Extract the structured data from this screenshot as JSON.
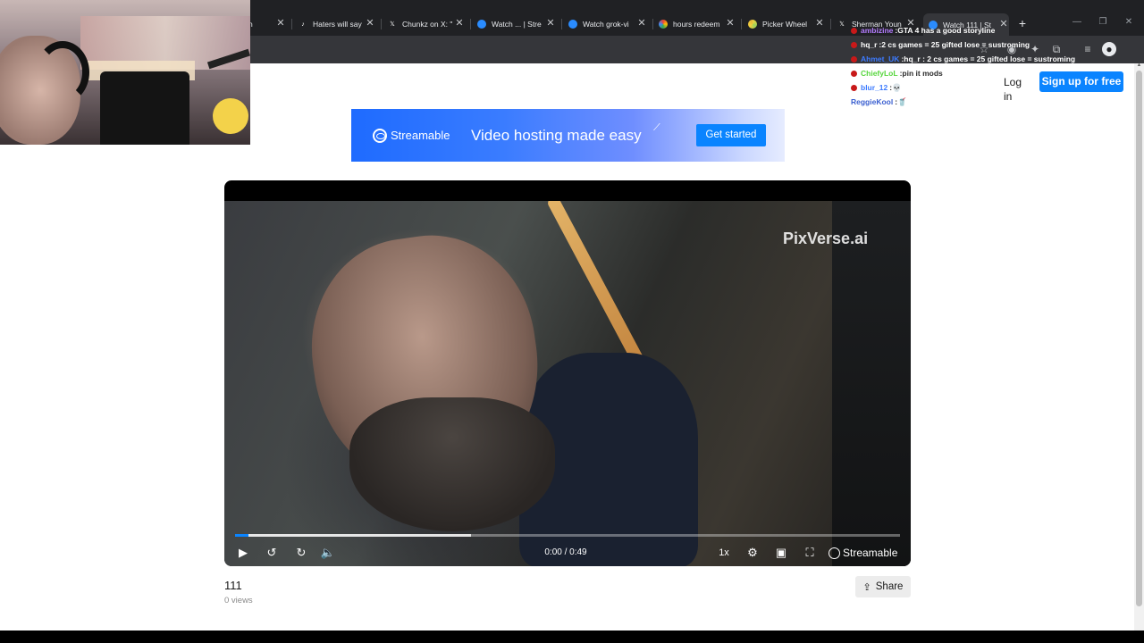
{
  "browser": {
    "tabs": [
      {
        "title": "n",
        "favicon": "page-icon"
      },
      {
        "title": "Haters will say",
        "favicon": "tiktok-icon"
      },
      {
        "title": "Chunkz on X: \"",
        "favicon": "x-icon"
      },
      {
        "title": "Watch ... | Stre",
        "favicon": "streamable-icon"
      },
      {
        "title": "Watch grok-vi",
        "favicon": "streamable-icon"
      },
      {
        "title": "hours redeem",
        "favicon": "colorful-icon"
      },
      {
        "title": "Picker Wheel",
        "favicon": "wheel-icon"
      },
      {
        "title": "Sherman Youn",
        "favicon": "x-icon"
      },
      {
        "title": "Watch 111 | St",
        "favicon": "streamable-icon",
        "active": true
      }
    ],
    "new_tab": "+",
    "close_glyph": "✕"
  },
  "header": {
    "login": "Log in",
    "signup": "Sign up for free"
  },
  "banner": {
    "logo": "Streamable",
    "tagline": "Video hosting made easy",
    "cta": "Get started"
  },
  "player": {
    "watermark": "PixVerse.ai",
    "time": "0:00 / 0:49",
    "speed": "1x",
    "brand": "Streamable",
    "progress_played": 0.02,
    "progress_buffered": 0.355
  },
  "video": {
    "title": "111",
    "views": "0 views",
    "share": "Share"
  },
  "chat": [
    {
      "user": "ambizine",
      "sep": " : ",
      "msg": "GTA 4 has a good storyline",
      "user_color": "#b47cff"
    },
    {
      "user": "hq_r",
      "sep": " : ",
      "msg": "2 cs games = 25 gifted lose = sustroming",
      "user_color": "#ffffff"
    },
    {
      "user": "Ahmet_UK",
      "sep": " : ",
      "msg": "hq_r : 2 cs games = 25 gifted lose = sustroming",
      "user_color": "#3d7bff"
    },
    {
      "user": "ChiefyLoL",
      "sep": " : ",
      "msg": "pin it mods",
      "user_color": "#57d63d"
    },
    {
      "user": "blur_12",
      "sep": " : ",
      "msg": "💀",
      "user_color": "#3d7bff"
    },
    {
      "user": "ReggieKool",
      "sep": " : ",
      "msg": "🥤",
      "user_color": "#3a5fd0"
    }
  ],
  "colors": {
    "accent": "#0a84ff",
    "chrome_dark": "#202124"
  }
}
